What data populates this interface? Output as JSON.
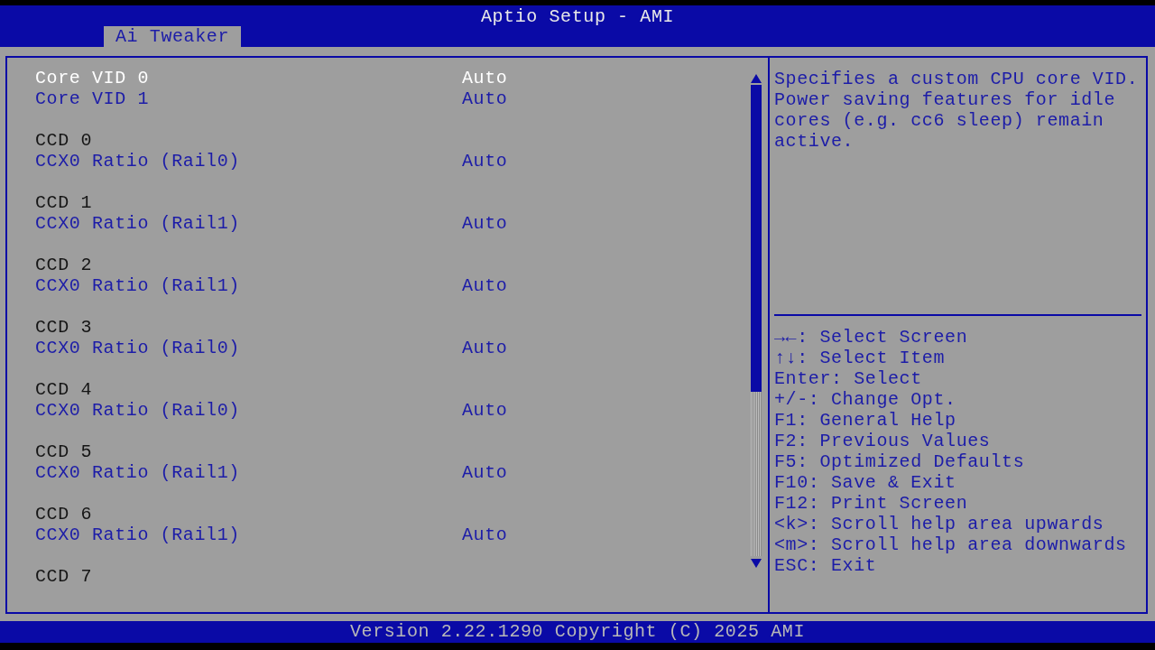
{
  "window": {
    "title": "Aptio Setup - AMI"
  },
  "tabs": [
    {
      "label": "Ai Tweaker",
      "selected": true
    }
  ],
  "items": [
    {
      "kind": "setting",
      "label": "Core VID 0",
      "value": "Auto",
      "selected": true
    },
    {
      "kind": "setting",
      "label": "Core VID 1",
      "value": "Auto",
      "selected": false
    },
    {
      "kind": "heading",
      "label": "CCD 0"
    },
    {
      "kind": "setting",
      "label": "CCX0 Ratio (Rail0)",
      "value": "Auto",
      "selected": false
    },
    {
      "kind": "heading",
      "label": "CCD 1"
    },
    {
      "kind": "setting",
      "label": "CCX0 Ratio (Rail1)",
      "value": "Auto",
      "selected": false
    },
    {
      "kind": "heading",
      "label": "CCD 2"
    },
    {
      "kind": "setting",
      "label": "CCX0 Ratio (Rail1)",
      "value": "Auto",
      "selected": false
    },
    {
      "kind": "heading",
      "label": "CCD 3"
    },
    {
      "kind": "setting",
      "label": "CCX0 Ratio (Rail0)",
      "value": "Auto",
      "selected": false
    },
    {
      "kind": "heading",
      "label": "CCD 4"
    },
    {
      "kind": "setting",
      "label": "CCX0 Ratio (Rail0)",
      "value": "Auto",
      "selected": false
    },
    {
      "kind": "heading",
      "label": "CCD 5"
    },
    {
      "kind": "setting",
      "label": "CCX0 Ratio (Rail1)",
      "value": "Auto",
      "selected": false
    },
    {
      "kind": "heading",
      "label": "CCD 6"
    },
    {
      "kind": "setting",
      "label": "CCX0 Ratio (Rail1)",
      "value": "Auto",
      "selected": false
    },
    {
      "kind": "heading",
      "label": "CCD 7"
    }
  ],
  "help": {
    "description": "Specifies a custom CPU core VID. Power saving features for idle cores (e.g. cc6 sleep) remain active.",
    "keys": [
      "→←: Select Screen",
      "↑↓: Select Item",
      "Enter: Select",
      "+/-: Change Opt.",
      "F1: General Help",
      "F2: Previous Values",
      "F5: Optimized Defaults",
      "F10: Save & Exit",
      "F12: Print Screen",
      "<k>: Scroll help area upwards",
      "<m>: Scroll help area downwards",
      "ESC: Exit"
    ]
  },
  "status_bar": "Version 2.22.1290 Copyright (C) 2025 AMI"
}
